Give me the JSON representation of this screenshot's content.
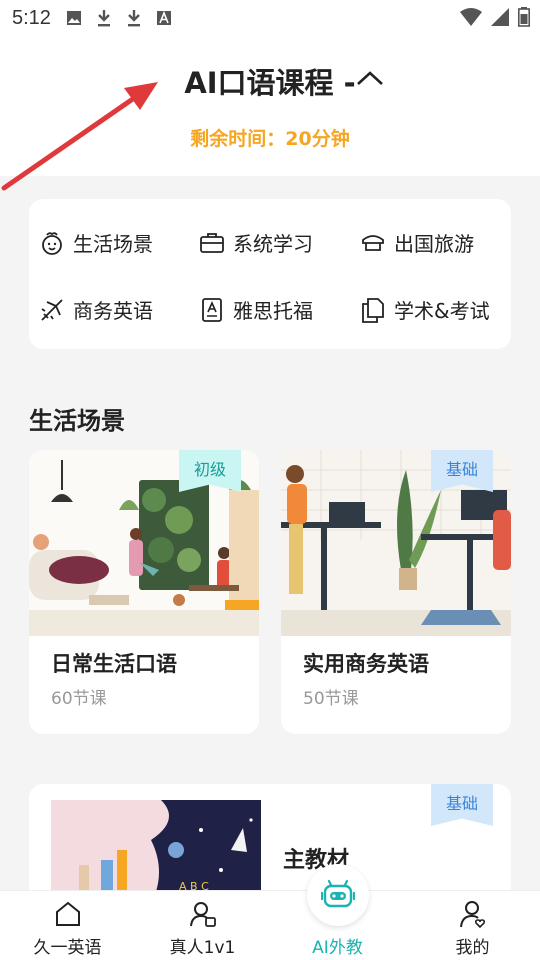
{
  "status_bar": {
    "time": "5:12"
  },
  "header": {
    "title": "AI口语课程 -",
    "remaining_label": "剩余时间：20分钟"
  },
  "categories": [
    {
      "label": "生活场景",
      "icon": "baby-face-icon"
    },
    {
      "label": "系统学习",
      "icon": "briefcase-icon"
    },
    {
      "label": "出国旅游",
      "icon": "cap-icon"
    },
    {
      "label": "商务英语",
      "icon": "airplane-icon"
    },
    {
      "label": "雅思托福",
      "icon": "document-a-icon"
    },
    {
      "label": "学术&考试",
      "icon": "copy-document-icon"
    }
  ],
  "section": {
    "title": "生活场景"
  },
  "courses": [
    {
      "name": "日常生活口语",
      "count": "60节课",
      "tag": "初级"
    },
    {
      "name": "实用商务英语",
      "count": "50节课",
      "tag": "基础"
    }
  ],
  "featured": {
    "name": "主教材",
    "tag": "基础"
  },
  "nav": [
    {
      "label": "久一英语",
      "icon": "home-icon"
    },
    {
      "label": "真人1v1",
      "icon": "teacher-icon"
    },
    {
      "label": "AI外教",
      "icon": "robot-icon"
    },
    {
      "label": "我的",
      "icon": "profile-icon"
    }
  ],
  "colors": {
    "accent": "#1bb3b0",
    "timer": "#f5a623",
    "arrow": "#e0393b"
  }
}
